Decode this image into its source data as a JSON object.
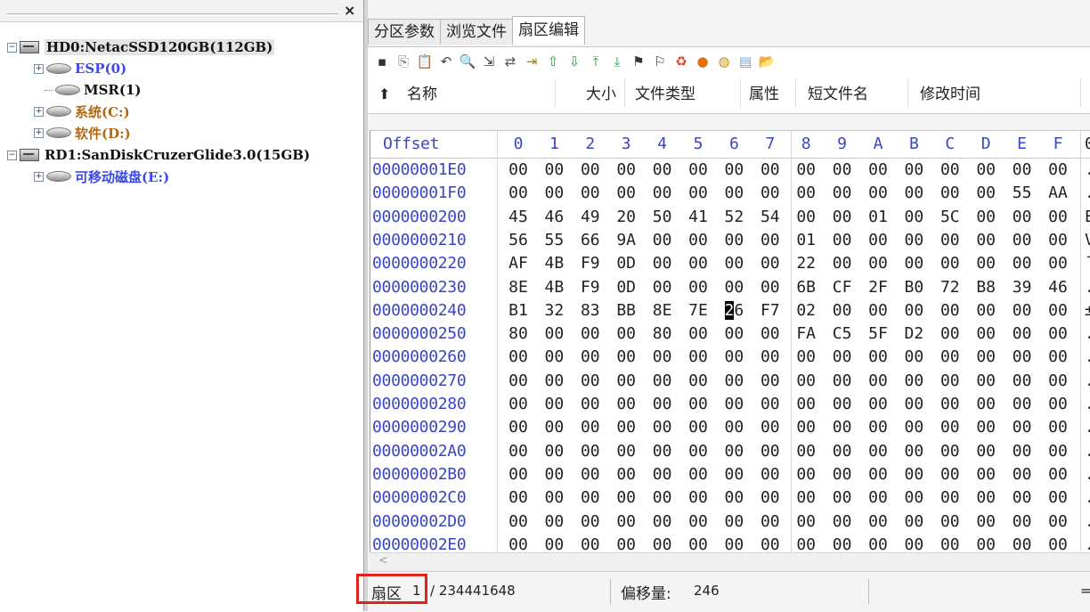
{
  "tree": {
    "nodes": [
      {
        "label": "HD0:NetacSSD120GB(112GB)",
        "level": 0,
        "type": "disk",
        "expander": "−",
        "color": "#111111",
        "selected": true
      },
      {
        "label": "ESP(0)",
        "level": 1,
        "type": "partition",
        "expander": "+",
        "color": "#3c49e8"
      },
      {
        "label": "MSR(1)",
        "level": 1,
        "type": "partition",
        "expander": "",
        "color": "#111111"
      },
      {
        "label": "系统(C:)",
        "level": 1,
        "type": "partition",
        "expander": "+",
        "color": "#b06a14"
      },
      {
        "label": "软件(D:)",
        "level": 1,
        "type": "partition",
        "expander": "+",
        "color": "#b06a14"
      },
      {
        "label": "RD1:SanDiskCruzerGlide3.0(15GB)",
        "level": 0,
        "type": "disk",
        "expander": "−",
        "color": "#111111"
      },
      {
        "label": "可移动磁盘(E:)",
        "level": 1,
        "type": "partition",
        "expander": "+",
        "color": "#3c49e8"
      }
    ],
    "close_label": "×"
  },
  "tabs": [
    {
      "label": "分区参数",
      "active": false
    },
    {
      "label": "浏览文件",
      "active": false
    },
    {
      "label": "扇区编辑",
      "active": true
    }
  ],
  "toolbar": {
    "icons": [
      "save-icon",
      "copy-icon",
      "paste-icon",
      "undo-icon",
      "find-icon",
      "find-next-icon",
      "replace-icon",
      "goto-icon",
      "prev-sector-icon",
      "next-sector-icon",
      "first-sector-icon",
      "last-sector-icon",
      "bookmark-icon",
      "jump-bookmark-icon",
      "recover-icon",
      "disk-icon",
      "partition-icon",
      "properties-icon",
      "open-icon"
    ],
    "glyphs": [
      "▪",
      "⎘",
      "📋",
      "↶",
      "🔍",
      "⇲",
      "⇄",
      "⇥",
      "⇧",
      "⇩",
      "⤒",
      "⤓",
      "⚑",
      "⚐",
      "♻",
      "●",
      "◍",
      "▤",
      "📂"
    ]
  },
  "file_columns": {
    "up_icon": "⬆",
    "headers": [
      "名称",
      "大小",
      "文件类型",
      "属性",
      "短文件名",
      "修改时间"
    ]
  },
  "hex": {
    "offset_header": "Offset",
    "column_headers": [
      "0",
      "1",
      "2",
      "3",
      "4",
      "5",
      "6",
      "7",
      "8",
      "9",
      "A",
      "B",
      "C",
      "D",
      "E",
      "F"
    ],
    "ascii_header": "0",
    "rows": [
      {
        "offset": "00000001E0",
        "bytes": [
          "00",
          "00",
          "00",
          "00",
          "00",
          "00",
          "00",
          "00",
          "00",
          "00",
          "00",
          "00",
          "00",
          "00",
          "00",
          "00"
        ],
        "ascii": "."
      },
      {
        "offset": "00000001F0",
        "bytes": [
          "00",
          "00",
          "00",
          "00",
          "00",
          "00",
          "00",
          "00",
          "00",
          "00",
          "00",
          "00",
          "00",
          "00",
          "55",
          "AA"
        ],
        "ascii": "."
      },
      {
        "offset": "0000000200",
        "bytes": [
          "45",
          "46",
          "49",
          "20",
          "50",
          "41",
          "52",
          "54",
          "00",
          "00",
          "01",
          "00",
          "5C",
          "00",
          "00",
          "00"
        ],
        "ascii": "E"
      },
      {
        "offset": "0000000210",
        "bytes": [
          "56",
          "55",
          "66",
          "9A",
          "00",
          "00",
          "00",
          "00",
          "01",
          "00",
          "00",
          "00",
          "00",
          "00",
          "00",
          "00"
        ],
        "ascii": "V"
      },
      {
        "offset": "0000000220",
        "bytes": [
          "AF",
          "4B",
          "F9",
          "0D",
          "00",
          "00",
          "00",
          "00",
          "22",
          "00",
          "00",
          "00",
          "00",
          "00",
          "00",
          "00"
        ],
        "ascii": "¯"
      },
      {
        "offset": "0000000230",
        "bytes": [
          "8E",
          "4B",
          "F9",
          "0D",
          "00",
          "00",
          "00",
          "00",
          "6B",
          "CF",
          "2F",
          "B0",
          "72",
          "B8",
          "39",
          "46"
        ],
        "ascii": "."
      },
      {
        "offset": "0000000240",
        "bytes": [
          "B1",
          "32",
          "83",
          "BB",
          "8E",
          "7E",
          "26",
          "F7",
          "02",
          "00",
          "00",
          "00",
          "00",
          "00",
          "00",
          "00"
        ],
        "ascii": "±"
      },
      {
        "offset": "0000000250",
        "bytes": [
          "80",
          "00",
          "00",
          "00",
          "80",
          "00",
          "00",
          "00",
          "FA",
          "C5",
          "5F",
          "D2",
          "00",
          "00",
          "00",
          "00"
        ],
        "ascii": "."
      },
      {
        "offset": "0000000260",
        "bytes": [
          "00",
          "00",
          "00",
          "00",
          "00",
          "00",
          "00",
          "00",
          "00",
          "00",
          "00",
          "00",
          "00",
          "00",
          "00",
          "00"
        ],
        "ascii": "."
      },
      {
        "offset": "0000000270",
        "bytes": [
          "00",
          "00",
          "00",
          "00",
          "00",
          "00",
          "00",
          "00",
          "00",
          "00",
          "00",
          "00",
          "00",
          "00",
          "00",
          "00"
        ],
        "ascii": "."
      },
      {
        "offset": "0000000280",
        "bytes": [
          "00",
          "00",
          "00",
          "00",
          "00",
          "00",
          "00",
          "00",
          "00",
          "00",
          "00",
          "00",
          "00",
          "00",
          "00",
          "00"
        ],
        "ascii": "."
      },
      {
        "offset": "0000000290",
        "bytes": [
          "00",
          "00",
          "00",
          "00",
          "00",
          "00",
          "00",
          "00",
          "00",
          "00",
          "00",
          "00",
          "00",
          "00",
          "00",
          "00"
        ],
        "ascii": "."
      },
      {
        "offset": "00000002A0",
        "bytes": [
          "00",
          "00",
          "00",
          "00",
          "00",
          "00",
          "00",
          "00",
          "00",
          "00",
          "00",
          "00",
          "00",
          "00",
          "00",
          "00"
        ],
        "ascii": "."
      },
      {
        "offset": "00000002B0",
        "bytes": [
          "00",
          "00",
          "00",
          "00",
          "00",
          "00",
          "00",
          "00",
          "00",
          "00",
          "00",
          "00",
          "00",
          "00",
          "00",
          "00"
        ],
        "ascii": "."
      },
      {
        "offset": "00000002C0",
        "bytes": [
          "00",
          "00",
          "00",
          "00",
          "00",
          "00",
          "00",
          "00",
          "00",
          "00",
          "00",
          "00",
          "00",
          "00",
          "00",
          "00"
        ],
        "ascii": "."
      },
      {
        "offset": "00000002D0",
        "bytes": [
          "00",
          "00",
          "00",
          "00",
          "00",
          "00",
          "00",
          "00",
          "00",
          "00",
          "00",
          "00",
          "00",
          "00",
          "00",
          "00"
        ],
        "ascii": "."
      },
      {
        "offset": "00000002E0",
        "bytes": [
          "00",
          "00",
          "00",
          "00",
          "00",
          "00",
          "00",
          "00",
          "00",
          "00",
          "00",
          "00",
          "00",
          "00",
          "00",
          "00"
        ],
        "ascii": "."
      }
    ],
    "cursor": {
      "row": 6,
      "col": 6
    }
  },
  "scroll_left_arrow": "<",
  "status": {
    "sector_label": "扇区",
    "sector_value": "1",
    "sector_total": "/ 234441648",
    "offset_label": "偏移量:",
    "offset_value": "246",
    "right_glyph": "="
  },
  "colors": {
    "offset_blue": "#3a45c4",
    "highlight_red": "#e1231c"
  }
}
